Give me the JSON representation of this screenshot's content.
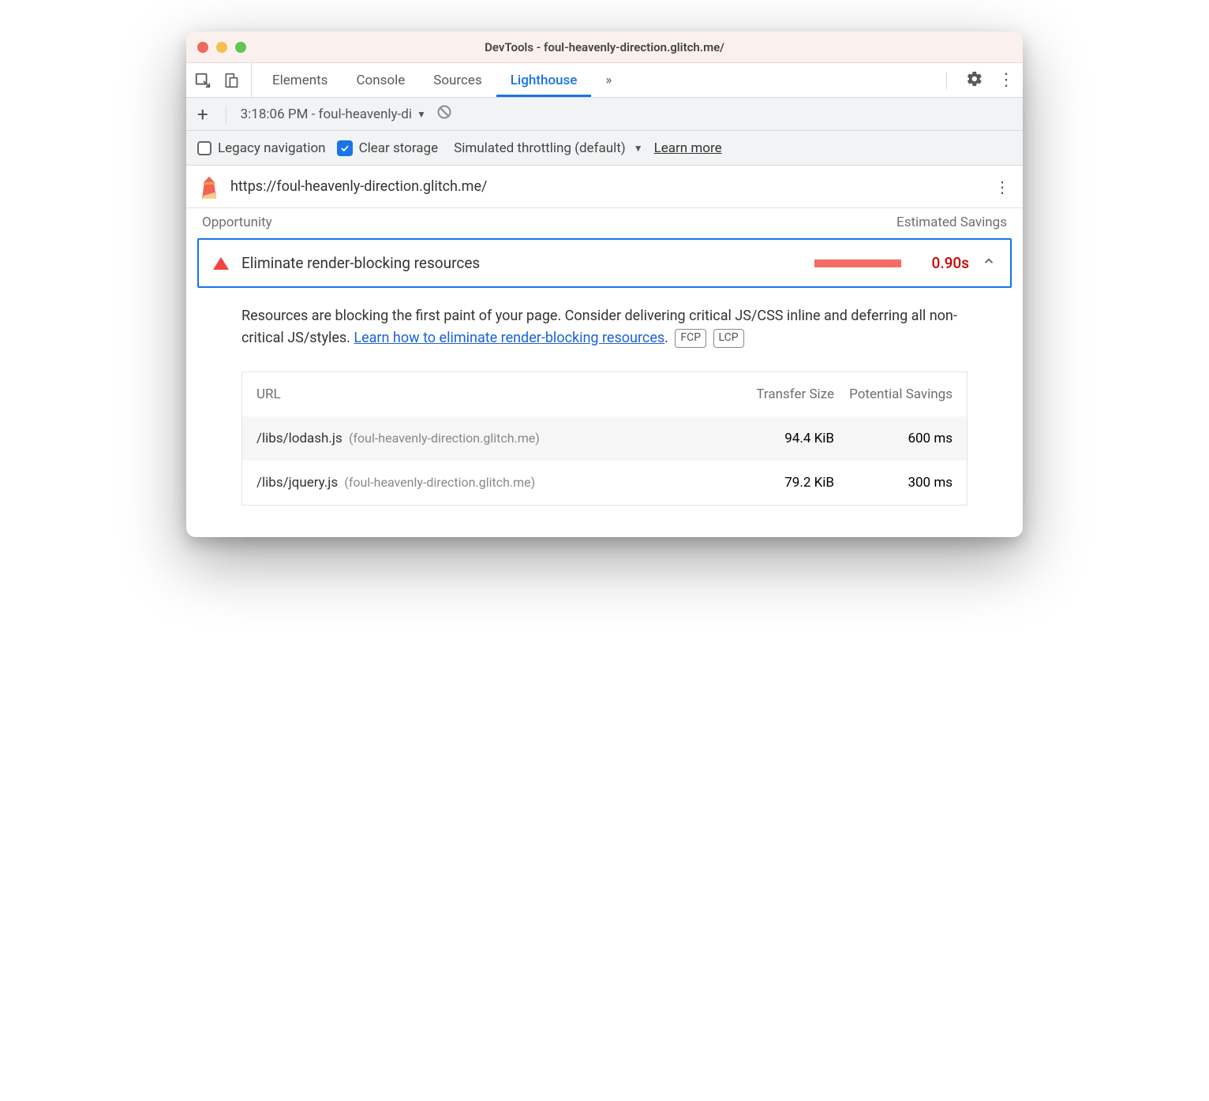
{
  "window": {
    "title": "DevTools - foul-heavenly-direction.glitch.me/"
  },
  "tabs": {
    "items": [
      "Elements",
      "Console",
      "Sources",
      "Lighthouse"
    ],
    "active": "Lighthouse"
  },
  "subbar": {
    "run_label": "3:18:06 PM - foul-heavenly-di"
  },
  "options": {
    "legacy_label": "Legacy navigation",
    "clear_label": "Clear storage",
    "throttling_label": "Simulated throttling (default)",
    "learn_more": "Learn more"
  },
  "url_row": {
    "url": "https://foul-heavenly-direction.glitch.me/"
  },
  "opp_header": {
    "left": "Opportunity",
    "right": "Estimated Savings"
  },
  "opp": {
    "title": "Eliminate render-blocking resources",
    "savings": "0.90s"
  },
  "desc": {
    "text1": "Resources are blocking the first paint of your page. Consider delivering critical JS/CSS inline and deferring all non-critical JS/styles. ",
    "link": "Learn how to eliminate render-blocking resources",
    "period": ".",
    "pill1": "FCP",
    "pill2": "LCP"
  },
  "table": {
    "headers": {
      "url": "URL",
      "size": "Transfer Size",
      "save": "Potential Savings"
    },
    "rows": [
      {
        "path": "/libs/lodash.js",
        "host": "(foul-heavenly-direction.glitch.me)",
        "size": "94.4 KiB",
        "save": "600 ms"
      },
      {
        "path": "/libs/jquery.js",
        "host": "(foul-heavenly-direction.glitch.me)",
        "size": "79.2 KiB",
        "save": "300 ms"
      }
    ]
  }
}
